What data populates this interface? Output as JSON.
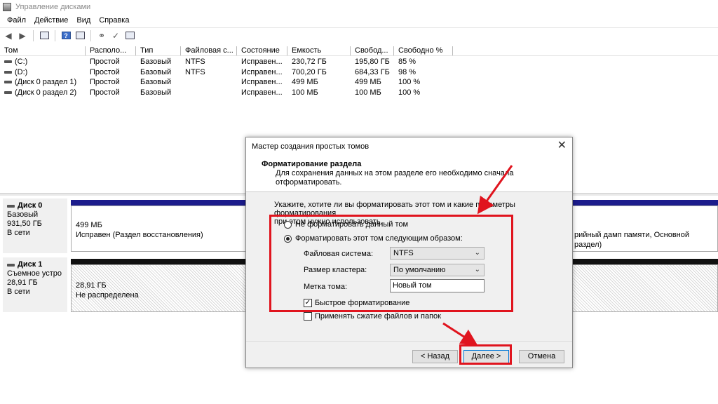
{
  "window": {
    "title": "Управление дисками"
  },
  "menu": [
    "Файл",
    "Действие",
    "Вид",
    "Справка"
  ],
  "volume_table": {
    "columns": [
      "Том",
      "Располо...",
      "Тип",
      "Файловая с...",
      "Состояние",
      "Емкость",
      "Свобод...",
      "Свободно %"
    ],
    "rows": [
      [
        "(C:)",
        "Простой",
        "Базовый",
        "NTFS",
        "Исправен...",
        "230,72 ГБ",
        "195,80 ГБ",
        "85 %"
      ],
      [
        "(D:)",
        "Простой",
        "Базовый",
        "NTFS",
        "Исправен...",
        "700,20 ГБ",
        "684,33 ГБ",
        "98 %"
      ],
      [
        "(Диск 0 раздел 1)",
        "Простой",
        "Базовый",
        "",
        "Исправен...",
        "499 МБ",
        "499 МБ",
        "100 %"
      ],
      [
        "(Диск 0 раздел 2)",
        "Простой",
        "Базовый",
        "",
        "Исправен...",
        "100 МБ",
        "100 МБ",
        "100 %"
      ]
    ]
  },
  "disks": {
    "disk0": {
      "name": "Диск 0",
      "type": "Базовый",
      "size": "931,50 ГБ",
      "status": "В сети",
      "partition_size": "499 МБ",
      "partition_status": "Исправен (Раздел восстановления)",
      "right_partition_text": "рийный дамп памяти, Основной раздел)"
    },
    "disk1": {
      "name": "Диск 1",
      "type": "Съемное устро",
      "size": "28,91 ГБ",
      "status": "В сети",
      "partition_size": "28,91 ГБ",
      "partition_status": "Не распределена"
    }
  },
  "dialog": {
    "title": "Мастер создания простых томов",
    "header_title": "Форматирование раздела",
    "header_sub_line1": "Для сохранения данных на этом разделе его необходимо сначала",
    "header_sub_line2": "отформатировать.",
    "intro_line1": "Укажите, хотите ли вы форматировать этот том и какие параметры форматирования",
    "intro_line2": "при этом нужно использовать.",
    "radio_no_format": "Не форматировать данный том",
    "radio_format": "Форматировать этот том следующим образом:",
    "selected_option": "format",
    "filesystem_label": "Файловая система:",
    "filesystem_value": "NTFS",
    "cluster_label": "Размер кластера:",
    "cluster_value": "По умолчанию",
    "volume_label_label": "Метка тома:",
    "volume_label_value": "Новый том",
    "quick_format_label": "Быстрое форматирование",
    "quick_format_checked": true,
    "compression_label": "Применять сжатие файлов и папок",
    "compression_checked": false,
    "back_button": "< Назад",
    "next_button": "Далее >",
    "cancel_button": "Отмена"
  },
  "colors": {
    "primary_partition_bar": "#1c1c8c",
    "unallocated_bar": "#111111",
    "highlight_red": "#e0141e",
    "focus_blue": "#0078d7"
  }
}
